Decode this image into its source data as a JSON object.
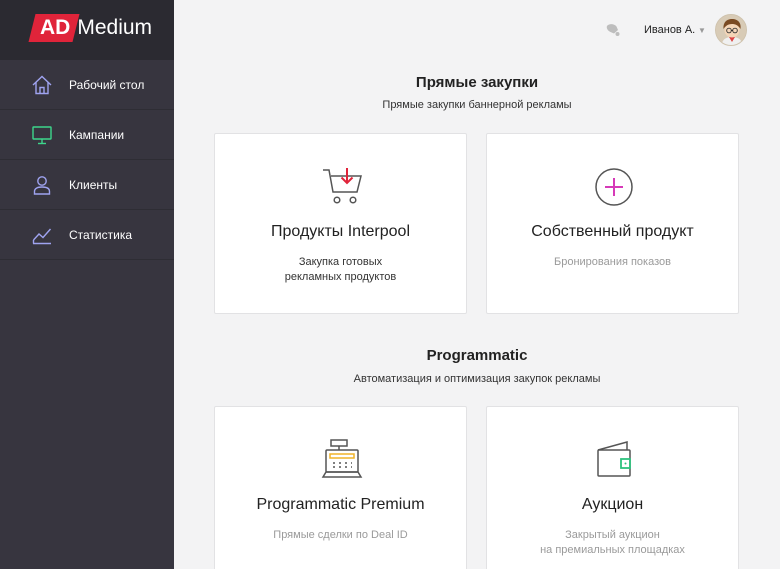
{
  "brand": {
    "part1": "AD",
    "part2": "Medium",
    "accent": "#e0243a"
  },
  "sidebar": {
    "items": [
      {
        "label": "Рабочий стол",
        "icon": "home-icon",
        "color": "#9fa3f0"
      },
      {
        "label": "Кампании",
        "icon": "monitor-icon",
        "color": "#3dd68c"
      },
      {
        "label": "Клиенты",
        "icon": "user-icon",
        "color": "#9fa3f0"
      },
      {
        "label": "Статистика",
        "icon": "chart-icon",
        "color": "#9fa3f0"
      }
    ]
  },
  "header": {
    "user_name": "Иванов А.",
    "notification_icon": "bell-icon",
    "avatar_icon": "avatar-icon"
  },
  "direct": {
    "title": "Прямые закупки",
    "subtitle": "Прямые закупки баннерной рекламы",
    "cards": [
      {
        "title": "Продукты Interpool",
        "desc": "Закупка готовых\nрекламных продуктов",
        "icon": "cart-icon"
      },
      {
        "title": "Собственный продукт",
        "desc": "Бронирования показов",
        "icon": "plus-circle-icon"
      }
    ]
  },
  "programmatic": {
    "title": "Programmatic",
    "subtitle": "Автоматизация и оптимизация закупок рекламы",
    "cards": [
      {
        "title": "Programmatic Premium",
        "desc": "Прямые сделки по Deal ID",
        "icon": "cash-register-icon"
      },
      {
        "title": "Аукцион",
        "desc": "Закрытый аукцион\nна премиальных площадках",
        "icon": "wallet-icon"
      }
    ]
  }
}
